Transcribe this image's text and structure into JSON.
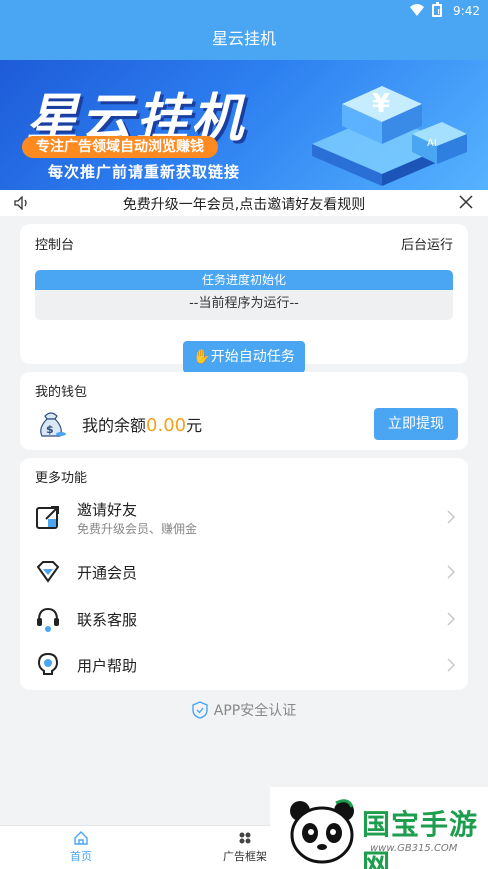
{
  "status_bar": {
    "time": "9:42",
    "battery_icon": "battery-icon",
    "wifi_icon": "wifi-icon"
  },
  "app_bar": {
    "title": "星云挂机"
  },
  "banner": {
    "title": "星云挂机",
    "slogan": "专注广告领域自动浏览赚钱",
    "subtitle": "每次推广前请重新获取链接"
  },
  "notice": {
    "text": "免费升级一年会员,点击邀请好友看规则",
    "icon": "speaker-icon",
    "close_icon": "close-icon"
  },
  "console": {
    "title": "控制台",
    "status": "后台运行",
    "progress_text": "任务进度初始化",
    "progress_value": 1.0,
    "running_text": "--当前程序为运行--",
    "start_button": "开始自动任务"
  },
  "wallet": {
    "title": "我的钱包",
    "balance_prefix": "我的余额",
    "balance_amount": "0.00",
    "balance_unit": "元",
    "withdraw_button": "立即提现"
  },
  "more": {
    "title": "更多功能",
    "items": [
      {
        "label": "邀请好友",
        "sub": "免费升级会员、赚佣金",
        "icon": "share-icon"
      },
      {
        "label": "开通会员",
        "sub": "",
        "icon": "vip-diamond-icon"
      },
      {
        "label": "联系客服",
        "sub": "",
        "icon": "headset-icon"
      },
      {
        "label": "用户帮助",
        "sub": "",
        "icon": "lightbulb-icon"
      }
    ]
  },
  "security": {
    "text": "APP安全认证",
    "icon": "shield-check-icon"
  },
  "bottom_nav": [
    {
      "label": "首页",
      "icon": "home-icon",
      "active": true
    },
    {
      "label": "广告框架",
      "icon": "grid-icon",
      "active": false
    }
  ],
  "watermark": {
    "text": "国宝手游网",
    "url": "www.GB315.COM"
  },
  "colors": {
    "primary": "#4aa6f2",
    "accent": "#f4a21a",
    "banner_pill": "#ff8a1f"
  }
}
